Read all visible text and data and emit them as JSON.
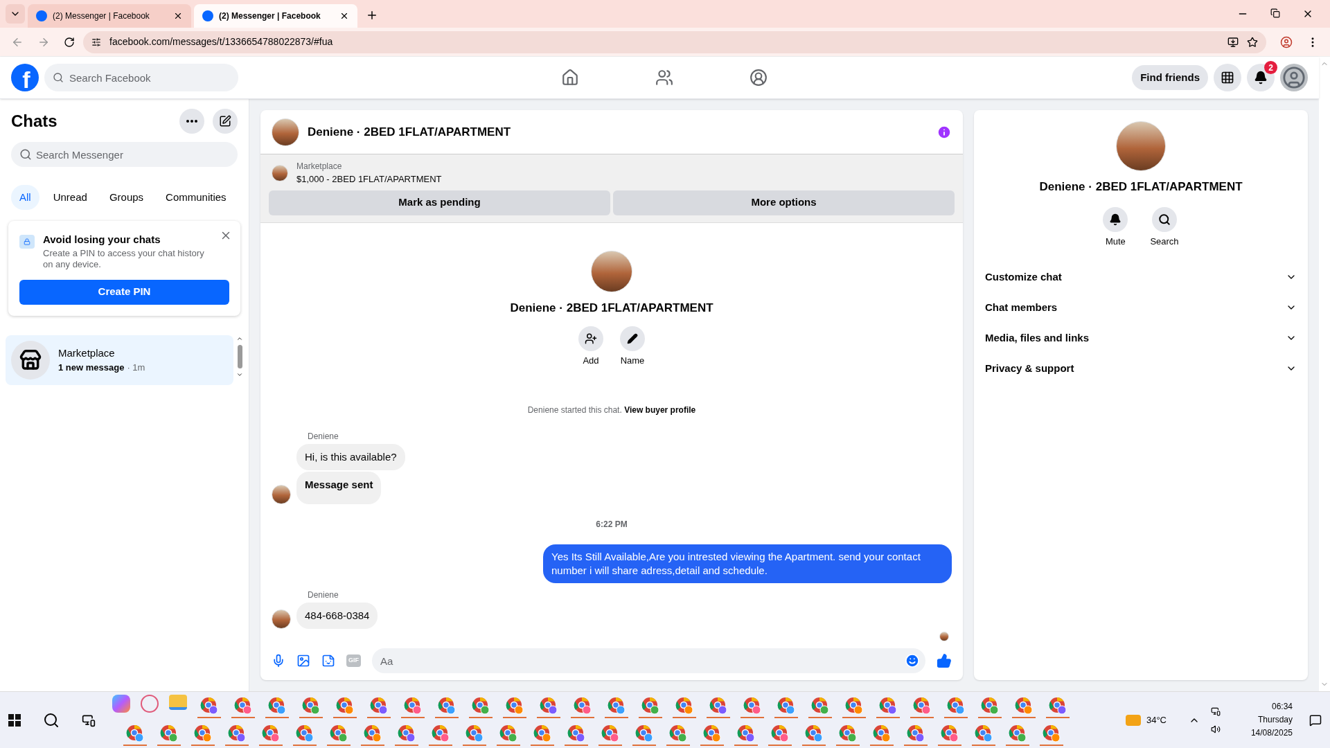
{
  "browser": {
    "tabs": [
      {
        "title": "(2) Messenger | Facebook",
        "selected": false
      },
      {
        "title": "(2) Messenger | Facebook",
        "selected": true
      }
    ],
    "url": "facebook.com/messages/t/1336654788022873/#fua"
  },
  "topbar": {
    "logo": "f",
    "search": {
      "placeholder": "Search Facebook"
    },
    "find_friends": "Find friends",
    "notification_count": "2"
  },
  "chats": {
    "title": "Chats",
    "search": {
      "placeholder": "Search Messenger"
    },
    "filters": [
      {
        "label": "All",
        "selected": true
      },
      {
        "label": "Unread",
        "selected": false
      },
      {
        "label": "Groups",
        "selected": false
      },
      {
        "label": "Communities",
        "selected": false
      }
    ],
    "pin_card": {
      "title": "Avoid losing your chats",
      "body": "Create a PIN to access your chat history on any device.",
      "button": "Create PIN"
    },
    "items": [
      {
        "name": "Marketplace",
        "preview": "1 new message",
        "time": "· 1m",
        "selected": true
      }
    ]
  },
  "conversation": {
    "title": "Deniene · 2BED 1FLAT/APARTMENT",
    "listing": {
      "source": "Marketplace",
      "item": "$1,000 - 2BED 1FLAT/APARTMENT",
      "buttons": [
        "Mark as pending",
        "More options"
      ]
    },
    "profile": {
      "name": "Deniene · 2BED 1FLAT/APARTMENT",
      "actions": [
        {
          "kind": "add",
          "label": "Add"
        },
        {
          "kind": "name",
          "label": "Name"
        }
      ]
    },
    "started": {
      "text": "Deniene started this chat.",
      "link": "View buyer profile"
    },
    "messages": [
      {
        "kind": "sender",
        "text": "Deniene"
      },
      {
        "kind": "incoming",
        "text": "Hi, is this available?",
        "bold": false,
        "avatar": false
      },
      {
        "kind": "incoming",
        "text": "Message sent",
        "bold": true,
        "avatar": true
      },
      {
        "kind": "time",
        "text": "6:22 PM"
      },
      {
        "kind": "outgoing",
        "text": "Yes Its Still Available,Are you intrested viewing the Apartment. send your contact number i will share adress,detail and schedule."
      },
      {
        "kind": "sender",
        "text": "Deniene"
      },
      {
        "kind": "incoming",
        "text": "484-668-0384",
        "bold": false,
        "avatar": true
      }
    ],
    "composer": {
      "placeholder": "Aa",
      "gif_label": "GIF"
    }
  },
  "details": {
    "name": "Deniene · 2BED 1FLAT/APARTMENT",
    "actions": [
      {
        "kind": "mute",
        "label": "Mute"
      },
      {
        "kind": "search",
        "label": "Search"
      }
    ],
    "sections": [
      "Customize chat",
      "Chat members",
      "Media, files and links",
      "Privacy & support"
    ]
  },
  "taskbar": {
    "weather": "34°C",
    "time": "06:34",
    "day": "Thursday",
    "date": "14/08/2025"
  }
}
